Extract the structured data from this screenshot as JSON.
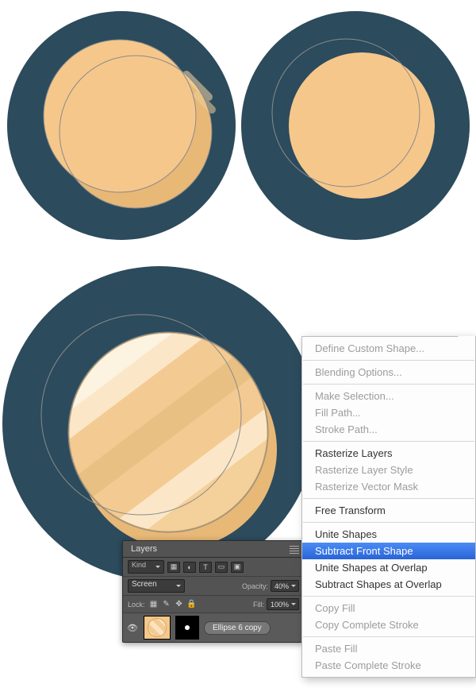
{
  "circles": {
    "bg_color": "#2c4b5d",
    "coin_main": "#f6c78b",
    "coin_dark": "#e8b877",
    "stripe_light": "#fbe7c8",
    "stripe_lighter": "#fdf3e1",
    "stripe_base": "#f3cb92",
    "stripe_dark": "#e8bf85",
    "outline": "#aaaaaa"
  },
  "layers_panel": {
    "tab": "Layers",
    "kind_label": "Kind",
    "blend_mode": "Screen",
    "opacity_label": "Opacity:",
    "opacity_value": "40%",
    "lock_label": "Lock:",
    "fill_label": "Fill:",
    "fill_value": "100%",
    "layer_name": "Ellipse 6 copy",
    "icons": {
      "t": "T"
    }
  },
  "context_menu": {
    "items": [
      {
        "label": "Define Custom Shape...",
        "state": "disabled"
      },
      {
        "sep": true
      },
      {
        "label": "Blending Options...",
        "state": "disabled"
      },
      {
        "sep": true
      },
      {
        "label": "Make Selection...",
        "state": "disabled"
      },
      {
        "label": "Fill Path...",
        "state": "disabled"
      },
      {
        "label": "Stroke Path...",
        "state": "disabled"
      },
      {
        "sep": true
      },
      {
        "label": "Rasterize Layers",
        "state": "enabled"
      },
      {
        "label": "Rasterize Layer Style",
        "state": "disabled"
      },
      {
        "label": "Rasterize Vector Mask",
        "state": "disabled"
      },
      {
        "sep": true
      },
      {
        "label": "Free Transform",
        "state": "enabled"
      },
      {
        "sep": true
      },
      {
        "label": "Unite Shapes",
        "state": "enabled"
      },
      {
        "label": "Subtract Front Shape",
        "state": "selected"
      },
      {
        "label": "Unite Shapes at Overlap",
        "state": "enabled"
      },
      {
        "label": "Subtract Shapes at Overlap",
        "state": "enabled"
      },
      {
        "sep": true
      },
      {
        "label": "Copy Fill",
        "state": "disabled"
      },
      {
        "label": "Copy Complete Stroke",
        "state": "disabled"
      },
      {
        "sep": true
      },
      {
        "label": "Paste Fill",
        "state": "disabled"
      },
      {
        "label": "Paste Complete Stroke",
        "state": "disabled"
      }
    ]
  }
}
